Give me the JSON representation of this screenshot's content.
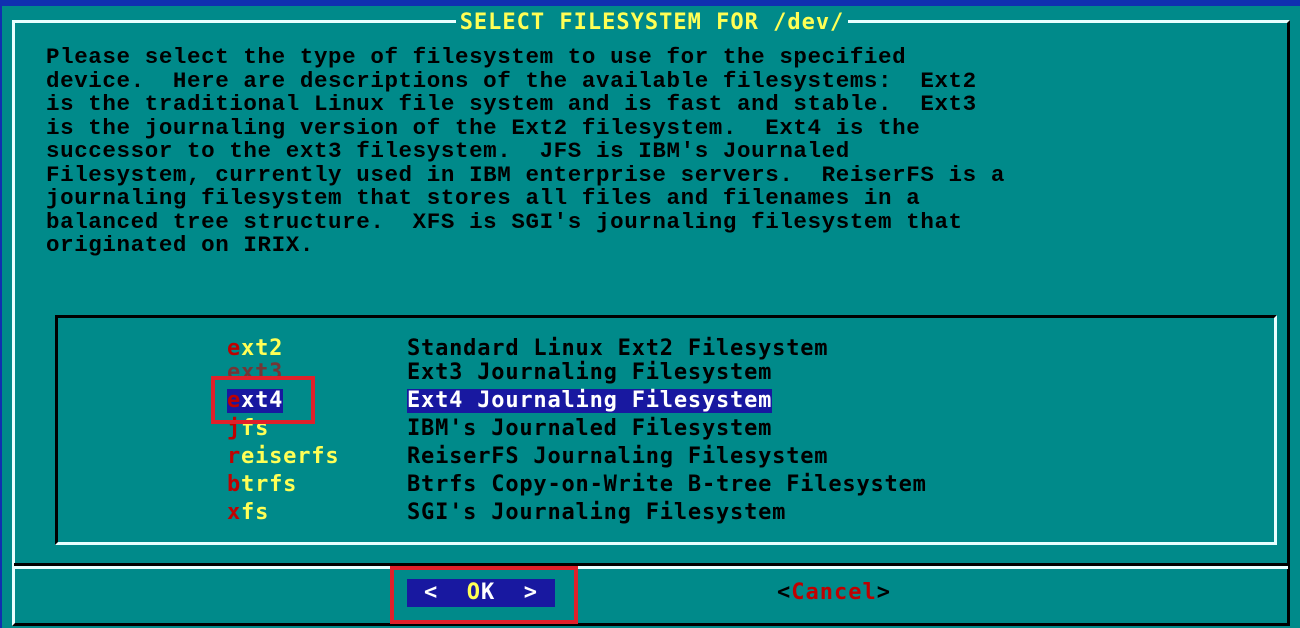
{
  "title": "SELECT FILESYSTEM FOR /dev/",
  "description_lines": [
    "Please select the type of filesystem to use for the specified",
    "device.  Here are descriptions of the available filesystems:  Ext2",
    "is the traditional Linux file system and is fast and stable.  Ext3",
    "is the journaling version of the Ext2 filesystem.  Ext4 is the",
    "successor to the ext3 filesystem.  JFS is IBM's Journaled",
    "Filesystem, currently used in IBM enterprise servers.  ReiserFS is a",
    "journaling filesystem that stores all files and filenames in a",
    "balanced tree structure.  XFS is SGI's journaling filesystem that",
    "originated on IRIX."
  ],
  "menu": {
    "selected": "ext4",
    "items": [
      {
        "hot": "e",
        "rest": "xt2",
        "desc": "Standard Linux Ext2 Filesystem"
      },
      {
        "hot": "e",
        "rest": "xt3",
        "desc": "Ext3 Journaling Filesystem"
      },
      {
        "hot": "e",
        "rest": "xt4",
        "desc": "Ext4 Journaling Filesystem"
      },
      {
        "hot": "j",
        "rest": "fs",
        "desc": "IBM's Journaled Filesystem"
      },
      {
        "hot": "r",
        "rest": "eiserfs",
        "desc": "ReiserFS Journaling Filesystem"
      },
      {
        "hot": "b",
        "rest": "trfs",
        "desc": "Btrfs Copy-on-Write B-tree Filesystem"
      },
      {
        "hot": "x",
        "rest": "fs",
        "desc": "SGI's Journaling Filesystem"
      }
    ]
  },
  "buttons": {
    "ok": {
      "left": "<  ",
      "hot": "O",
      "rest": "K",
      "right": "  >"
    },
    "cancel": {
      "left": "<",
      "hot": "C",
      "rest": "ancel",
      "right": ">"
    }
  },
  "colors": {
    "background": "#008a8a",
    "title": "#ffff55",
    "selection": "#1818a0",
    "hotkey": "#c00000",
    "annotation_box": "#e0202a"
  }
}
